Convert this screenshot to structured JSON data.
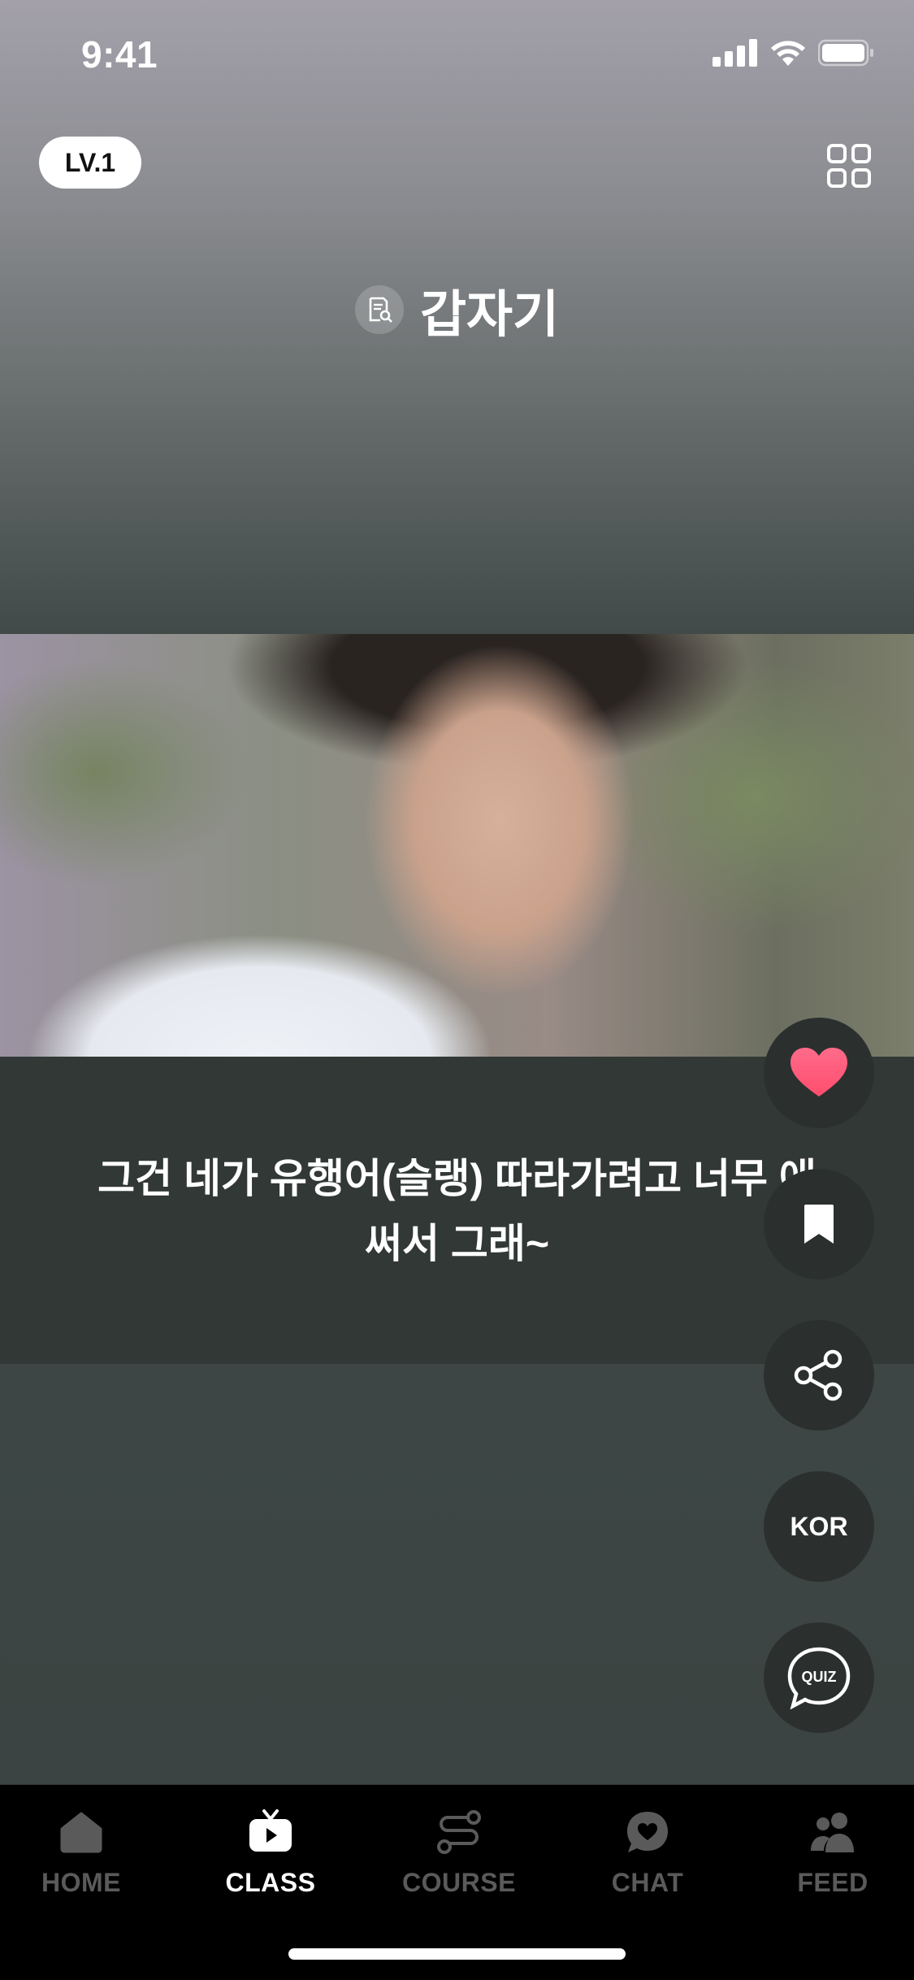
{
  "status_bar": {
    "time": "9:41"
  },
  "header": {
    "level_badge": "LV.1",
    "title": "갑자기"
  },
  "subtitle": {
    "line1": "그건 네가 유행어(슬랭) 따라가려고 너무 애",
    "line2": "써서 그래~"
  },
  "side_actions": {
    "language_label": "KOR",
    "quiz_label": "QUIZ"
  },
  "tabbar": {
    "tabs": [
      {
        "label": "HOME",
        "icon": "home-icon",
        "active": false
      },
      {
        "label": "CLASS",
        "icon": "play-tv-icon",
        "active": true
      },
      {
        "label": "COURSE",
        "icon": "route-icon",
        "active": false
      },
      {
        "label": "CHAT",
        "icon": "chat-heart-icon",
        "active": false
      },
      {
        "label": "FEED",
        "icon": "people-icon",
        "active": false
      }
    ]
  },
  "colors": {
    "like": "#ff5577",
    "active_tab": "#ffffff",
    "inactive_tab": "#5a5a5a"
  }
}
